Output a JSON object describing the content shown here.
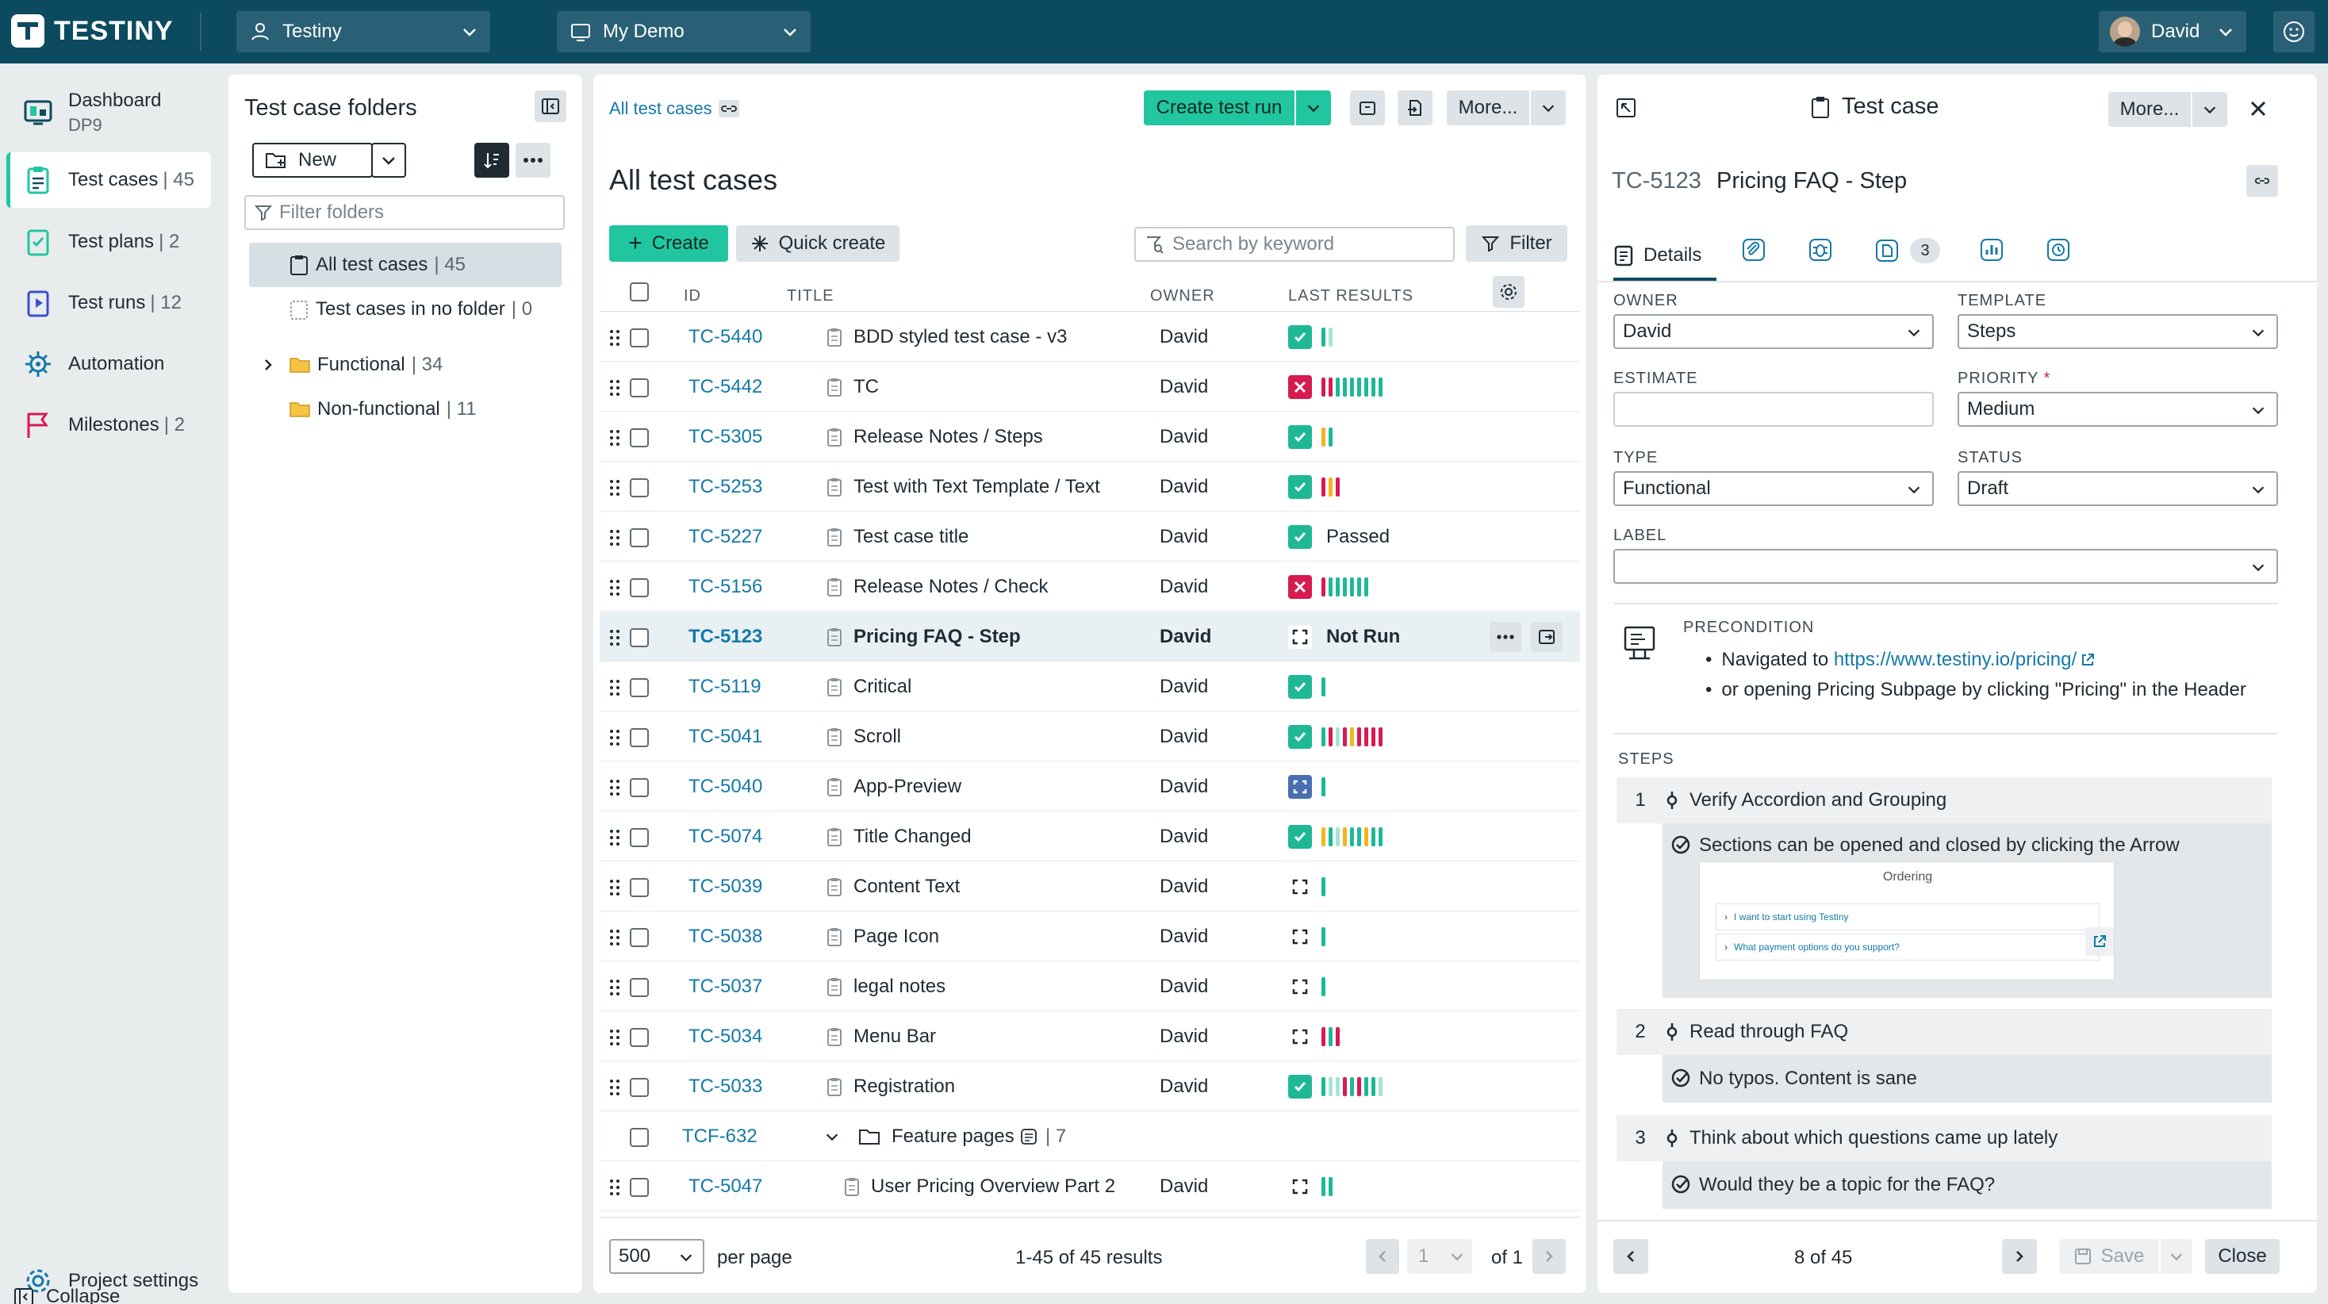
{
  "app": {
    "logo_text": "TESTINY",
    "workspace": "Testiny",
    "project": "My Demo",
    "user": "David"
  },
  "colors": {
    "accent": "#21c6a0",
    "header": "#0c4a5f",
    "pass": "#1eb896",
    "fail": "#d71a50",
    "link": "#1479a8"
  },
  "nav": {
    "items": [
      {
        "label": "Dashboard",
        "sub": "DP9",
        "icon": "dashboard-icon"
      },
      {
        "label": "Test cases",
        "count": "| 45",
        "icon": "clipboard-icon"
      },
      {
        "label": "Test plans",
        "count": "| 2",
        "icon": "plan-icon"
      },
      {
        "label": "Test runs",
        "count": "| 12",
        "icon": "run-icon"
      },
      {
        "label": "Automation",
        "count": "",
        "icon": "automation-icon"
      },
      {
        "label": "Milestones",
        "count": "| 2",
        "icon": "flag-icon"
      }
    ],
    "project_settings": "Project settings",
    "collapse": "Collapse"
  },
  "folders": {
    "title": "Test case folders",
    "new_label": "New",
    "filter_placeholder": "Filter folders",
    "items": [
      {
        "label": "All test cases",
        "count": "| 45"
      },
      {
        "label": "Test cases in no folder",
        "count": "| 0"
      },
      {
        "label": "Functional",
        "count": "| 34"
      },
      {
        "label": "Non-functional",
        "count": "| 11"
      }
    ]
  },
  "list": {
    "breadcrumb": "All test cases",
    "create_run": "Create test run",
    "more": "More...",
    "heading": "All test cases",
    "create": "Create",
    "quick_create": "Quick create",
    "search_placeholder": "Search by keyword",
    "filter": "Filter",
    "columns": {
      "id": "ID",
      "title": "TITLE",
      "owner": "OWNER",
      "results": "LAST RESULTS"
    },
    "rows": [
      {
        "id": "TC-5440",
        "title": "BDD styled test case - v3",
        "owner": "David",
        "status": "pass",
        "hist": [
          "pass",
          "lpass"
        ]
      },
      {
        "id": "TC-5442",
        "title": "TC",
        "owner": "David",
        "status": "fail",
        "hist": [
          "fail",
          "fail",
          "pass",
          "pass",
          "pass",
          "pass",
          "pass",
          "pass",
          "pass"
        ]
      },
      {
        "id": "TC-5305",
        "title": "Release Notes / Steps",
        "owner": "David",
        "status": "pass",
        "hist": [
          "warn",
          "pass"
        ]
      },
      {
        "id": "TC-5253",
        "title": "Test with Text Template / Text",
        "owner": "David",
        "status": "pass",
        "hist": [
          "fail",
          "warn",
          "fail"
        ]
      },
      {
        "id": "TC-5227",
        "title": "Test case title",
        "owner": "David",
        "status": "pass",
        "text": "Passed",
        "hist": []
      },
      {
        "id": "TC-5156",
        "title": "Release Notes / Check",
        "owner": "David",
        "status": "fail",
        "hist": [
          "fail",
          "pass",
          "pass",
          "pass",
          "pass",
          "pass",
          "pass"
        ]
      },
      {
        "id": "TC-5123",
        "title": "Pricing FAQ - Step",
        "owner": "David",
        "status": "nr",
        "text": "Not Run",
        "hist": [],
        "selected": true
      },
      {
        "id": "TC-5119",
        "title": "Critical",
        "owner": "David",
        "status": "pass",
        "hist": [
          "pass"
        ]
      },
      {
        "id": "TC-5041",
        "title": "Scroll",
        "owner": "David",
        "status": "pass",
        "hist": [
          "pass",
          "fail",
          "lpass",
          "fail",
          "warn",
          "fail",
          "fail",
          "fail",
          "fail"
        ]
      },
      {
        "id": "TC-5040",
        "title": "App-Preview",
        "owner": "David",
        "status": "blk",
        "hist": [
          "pass"
        ]
      },
      {
        "id": "TC-5074",
        "title": "Title Changed",
        "owner": "David",
        "status": "pass",
        "hist": [
          "warn",
          "pass",
          "lpass",
          "warn",
          "pass",
          "pass",
          "warn",
          "pass",
          "pass"
        ]
      },
      {
        "id": "TC-5039",
        "title": "Content Text",
        "owner": "David",
        "status": "nr",
        "hist": [
          "pass"
        ]
      },
      {
        "id": "TC-5038",
        "title": "Page Icon",
        "owner": "David",
        "status": "nr",
        "hist": [
          "pass"
        ]
      },
      {
        "id": "TC-5037",
        "title": "legal notes",
        "owner": "David",
        "status": "nr",
        "hist": [
          "pass"
        ]
      },
      {
        "id": "TC-5034",
        "title": "Menu Bar",
        "owner": "David",
        "status": "nr",
        "hist": [
          "fail",
          "pass",
          "fail"
        ]
      },
      {
        "id": "TC-5033",
        "title": "Registration",
        "owner": "David",
        "status": "pass",
        "hist": [
          "pass",
          "lpass",
          "lpass",
          "fail",
          "pass",
          "fail",
          "pass",
          "pass",
          "lpass"
        ]
      }
    ],
    "folder_row": {
      "id": "TCF-632",
      "title": "Feature pages",
      "count": "| 7"
    },
    "last_row": {
      "id": "TC-5047",
      "title": "User Pricing Overview Part 2",
      "owner": "David",
      "status": "nr",
      "hist": [
        "pass",
        "pass"
      ]
    },
    "page_size": "500",
    "per_page": "per page",
    "results": "1-45 of 45 results",
    "page": "1",
    "of_pages": "of 1"
  },
  "detail": {
    "header": "Test case",
    "more": "More...",
    "id": "TC-5123",
    "title": "Pricing FAQ - Step",
    "tab_details": "Details",
    "tab_count": "3",
    "owner_label": "OWNER",
    "owner": "David",
    "template_label": "TEMPLATE",
    "template": "Steps",
    "estimate_label": "ESTIMATE",
    "estimate": "",
    "priority_label": "PRIORITY",
    "priority": "Medium",
    "type_label": "TYPE",
    "type": "Functional",
    "status_label": "STATUS",
    "status": "Draft",
    "label_label": "LABEL",
    "precondition_label": "PRECONDITION",
    "pre_line1_prefix": "Navigated to ",
    "pre_link": "https://www.testiny.io/pricing/",
    "pre_line2": "or opening Pricing Subpage by clicking \"Pricing\" in the Header",
    "steps_label": "STEPS",
    "steps": [
      {
        "num": "1",
        "text": "Verify Accordion and Grouping",
        "expected": "Sections can be opened and closed by clicking the Arrow"
      },
      {
        "num": "2",
        "text": "Read through FAQ",
        "expected": "No typos. Content is sane"
      },
      {
        "num": "3",
        "text": "Think about which questions came up lately",
        "expected": "Would they be a topic for the FAQ?"
      }
    ],
    "shot": {
      "title": "Ordering",
      "q1": "I want to start using Testiny",
      "q2": "What payment options do you support?"
    },
    "position": "8 of 45",
    "save": "Save",
    "close": "Close"
  }
}
